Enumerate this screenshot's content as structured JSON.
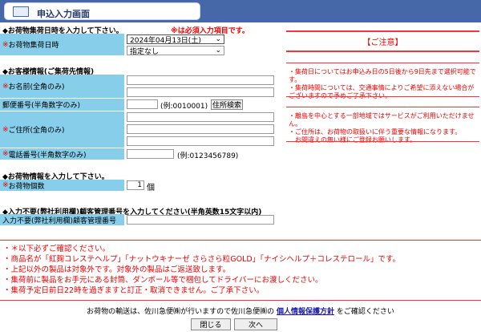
{
  "header": {
    "title": "申込入力画面",
    "icon": "package-box-icon"
  },
  "section1": {
    "heading": "◆お荷物集荷日時を入力して下さい。",
    "required_note": "※は必須入力項目です。",
    "pickup_label": "お荷物集荷日時",
    "date_value": "2024年04月13日(土)",
    "time_value": "指定なし"
  },
  "section2": {
    "heading": "◆お客様情報(ご集荷先情報)",
    "name_label": "お名前(全角のみ)",
    "postal_label": "郵便番号(半角数字のみ)",
    "postal_example": "(例:0010001)",
    "address_search": "住所検索",
    "address_label": "ご住所(全角のみ)",
    "phone_label": "電話番号(半角数字のみ)",
    "phone_example": "(例:0123456789)"
  },
  "section3": {
    "heading": "◆お荷物情報を入力して下さい。",
    "count_label": "お荷物個数",
    "count_value": "1",
    "count_unit": "個"
  },
  "section4": {
    "heading": "◆入力不要(弊社利用欄)顧客管理番号を入力してください(半角英数15文字以内)",
    "label": "入力不要(弊社利用欄)顧客管理番号"
  },
  "req_mark": "※",
  "notice": {
    "title": "【ご注意】",
    "group1": [
      "・集荷日についてはお申込み日の5日後から9日先まで選択可能です。",
      "・集荷時間については、交通事情によりご希望に添えない場合がございますので予めご了承下さい。"
    ],
    "group2": [
      "・離島を中心とする一部地域ではサービスがご利用いただけません。",
      "・ご住所は、お荷物の取扱いに伴う重要な情報になります。",
      "　お間違えの無い様にご登録お願いします。"
    ]
  },
  "footer_notes": [
    "・＊以下必ずご確認ください。",
    "・商品名が「紅麹コレステヘルプ」「ナットウキナーゼ さらさら粒GOLD」「ナイシヘルプ＋コレステロール」です。",
    "・上記以外の製品は対象外です。対象外の製品はご返送致します。",
    "・集荷前に製品をお手元にある封筒、ダンボール等で梱包してドライバーにお渡しください。",
    "・集荷予定日前日22時を過ぎますと訂正・取消できません。ご了承下さい。"
  ],
  "privacy": {
    "before": "お荷物の輸送は、佐川急便㈱が行いますので佐川急便㈱の",
    "link": "個人情報保護方針",
    "after": "をご確認ください"
  },
  "buttons": {
    "close": "閉じる",
    "next": "次へ"
  },
  "colors": {
    "header": "#4668a8",
    "label_bg": "#87ceeb",
    "warning": "#ee0000"
  }
}
